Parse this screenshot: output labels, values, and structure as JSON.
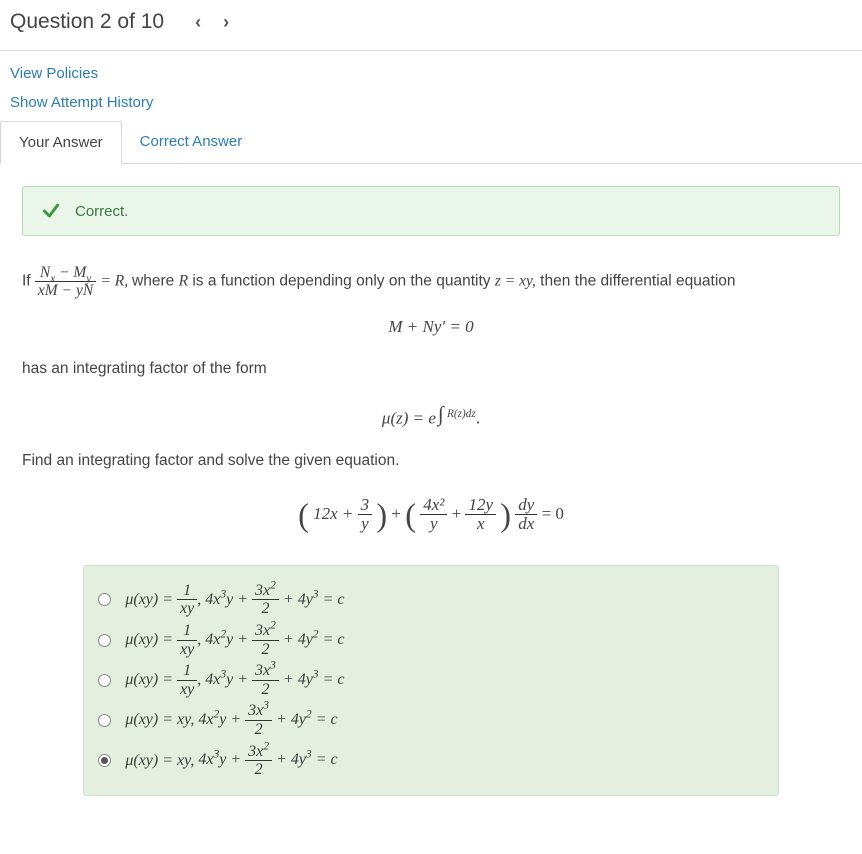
{
  "header": {
    "title": "Question 2 of 10",
    "prev_icon": "‹",
    "next_icon": "›"
  },
  "links": {
    "policies": "View Policies",
    "history": "Show Attempt History"
  },
  "tabs": {
    "your_answer": "Your Answer",
    "correct_answer": "Correct Answer"
  },
  "banner": {
    "label": "Correct."
  },
  "problem": {
    "if": "If ",
    "frac_num": "Nₓ − Mᵧ",
    "frac_den": "xM − yN",
    "eq_R": " = R, ",
    "where": " where ",
    "R_is": "R",
    "is_func": " is a function depending only on the quantity ",
    "z_eq_xy": "z = xy,",
    "then": " then the differential equation",
    "eq1": "M + Ny′ = 0",
    "has_factor": "has an integrating factor of the form",
    "mu_z": "μ(z) = e",
    "int_label": "∫",
    "rz_dz": "R(z)dz",
    "period": ".",
    "find": "Find an integrating factor and solve the given equation.",
    "main_eq_l": "12x + ",
    "main_eq_frac1_num": "3",
    "main_eq_frac1_den": "y",
    "main_eq_plus": " + ",
    "main_eq_frac2_num": "4x²",
    "main_eq_frac2_den": "y",
    "main_eq_plus2": " + ",
    "main_eq_frac3_num": "12y",
    "main_eq_frac3_den": "x",
    "main_eq_dy_num": "dy",
    "main_eq_dy_den": "dx",
    "main_eq_zero": " = 0"
  },
  "options": [
    {
      "mu_pre": "μ(xy) = ",
      "mu_frac_num": "1",
      "mu_frac_den": "xy",
      "sep": ",  ",
      "sol_pre": "4x³y + ",
      "sol_frac_num": "3x²",
      "sol_frac_den": "2",
      "sol_post": " + 4y³ = c",
      "selected": false
    },
    {
      "mu_pre": "μ(xy) = ",
      "mu_frac_num": "1",
      "mu_frac_den": "xy",
      "sep": ",  ",
      "sol_pre": "4x²y + ",
      "sol_frac_num": "3x²",
      "sol_frac_den": "2",
      "sol_post": " + 4y² = c",
      "selected": false
    },
    {
      "mu_pre": "μ(xy) = ",
      "mu_frac_num": "1",
      "mu_frac_den": "xy",
      "sep": ",  ",
      "sol_pre": "4x³y + ",
      "sol_frac_num": "3x³",
      "sol_frac_den": "2",
      "sol_post": " + 4y³ = c",
      "selected": false
    },
    {
      "mu_pre": "μ(xy) = xy,  ",
      "mu_frac_num": "",
      "mu_frac_den": "",
      "sep": "",
      "sol_pre": "4x²y + ",
      "sol_frac_num": "3x³",
      "sol_frac_den": "2",
      "sol_post": " + 4y² = c",
      "selected": false
    },
    {
      "mu_pre": "μ(xy) = xy,  ",
      "mu_frac_num": "",
      "mu_frac_den": "",
      "sep": "",
      "sol_pre": "4x³y + ",
      "sol_frac_num": "3x²",
      "sol_frac_den": "2",
      "sol_post": " + 4y³ = c",
      "selected": true
    }
  ]
}
